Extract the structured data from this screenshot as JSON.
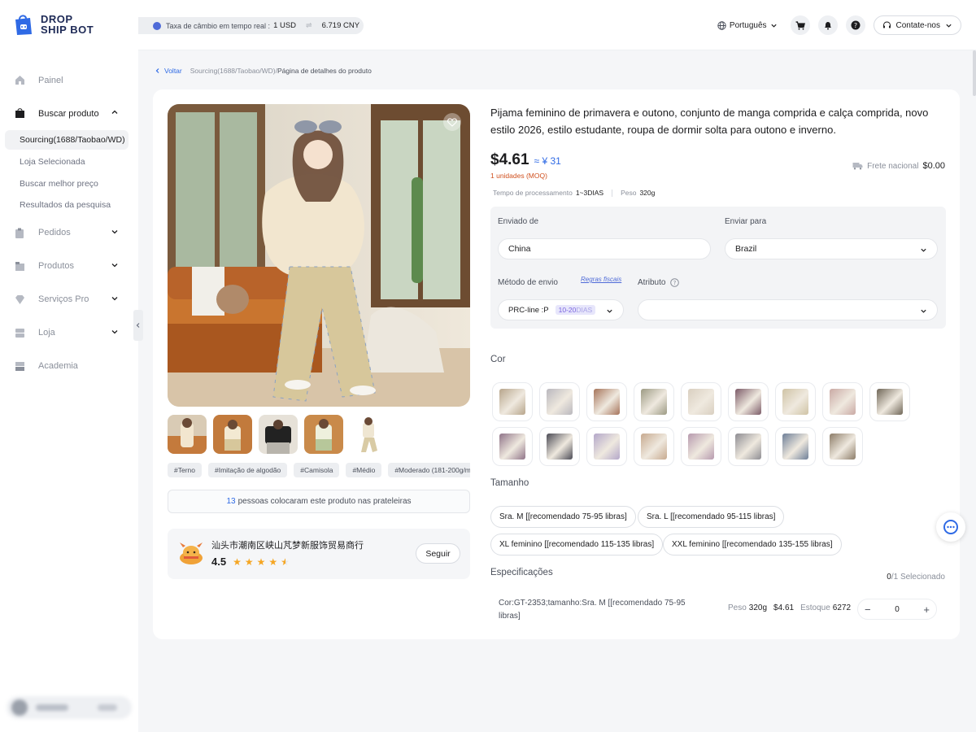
{
  "logo": {
    "line1": "DROP",
    "line2": "SHIP BOT"
  },
  "header": {
    "rate_label": "Taxa de câmbio em tempo real :",
    "rate_usd": "1 USD",
    "rate_cny": "6.719 CNY",
    "language": "Português",
    "contact": "Contate-nos"
  },
  "sidebar": {
    "items": [
      {
        "label": "Painel",
        "icon": "home-icon"
      },
      {
        "label": "Buscar produto",
        "icon": "bag-icon",
        "expanded": true
      },
      {
        "label": "Pedidos",
        "icon": "clipboard-icon"
      },
      {
        "label": "Produtos",
        "icon": "box-icon"
      },
      {
        "label": "Serviços Pro",
        "icon": "diamond-icon"
      },
      {
        "label": "Loja",
        "icon": "store-icon"
      },
      {
        "label": "Academia",
        "icon": "academy-icon"
      }
    ],
    "subitems": [
      {
        "label": "Sourcing(1688/Taobao/WD)",
        "selected": true
      },
      {
        "label": "Loja Selecionada"
      },
      {
        "label": "Buscar melhor preço"
      },
      {
        "label": "Resultados da pesquisa"
      }
    ]
  },
  "breadcrumb": {
    "back": "Voltar",
    "path": "Sourcing(1688/Taobao/WD)/",
    "current": "Página de detalhes do produto"
  },
  "product": {
    "title": "Pijama feminino de primavera e outono, conjunto de manga comprida e calça comprida, novo estilo 2026, estilo estudante, roupa de dormir solta para outono e inverno.",
    "price_usd": "$4.61",
    "price_cny": "≈ ¥ 31",
    "moq": "1 unidades (MOQ)",
    "processing_label": "Tempo de processamento",
    "processing_value": "1~3DIAS",
    "weight_label": "Peso",
    "weight_value": "320g",
    "shipping_label": "Frete nacional",
    "shipping_value": "$0.00"
  },
  "tags": [
    "#Terno",
    "#Imitação de algodão",
    "#Camisola",
    "#Médio",
    "#Moderado (181-200g/m"
  ],
  "shelf": {
    "count": "13",
    "text": "pessoas colocaram este produto nas prateleiras"
  },
  "shop": {
    "name": "汕头市潮南区峡山芃梦新服饰贸易商行",
    "rating": "4.5",
    "stars": 4.5,
    "follow": "Seguir"
  },
  "shipping": {
    "from_label": "Enviado de",
    "from_value": "China",
    "to_label": "Enviar para",
    "to_value": "Brazil",
    "method_label": "Método de envio",
    "rules_link": "Regras fiscais",
    "method_value": "PRC-line :P",
    "method_days": "10-20",
    "method_days_unit": "DIAS",
    "attribute_label": "Atributo"
  },
  "colors": {
    "label": "Cor",
    "swatches": [
      "#b7a58b",
      "#b9b7bd",
      "#a6745a",
      "#9c9a83",
      "#d9cfc0",
      "#7b5a67",
      "#cfc3a5",
      "#c9a9a4",
      "#6f6657",
      "#8f7488",
      "#4b4b55",
      "#b3a7c9",
      "#c7aa8f",
      "#b79aae",
      "#8d8c92",
      "#6e7f98",
      "#8c7c68"
    ]
  },
  "sizes": {
    "label": "Tamanho",
    "options": [
      "Sra. M [[recomendado 75-95 libras]",
      "Sra. L [[recomendado 95-115 libras]",
      "XL feminino [[recomendado 115-135 libras]",
      "XXL feminino [[recomendado 135-155 libras]"
    ]
  },
  "specs": {
    "label": "Especificações",
    "selected_count": "0",
    "selected_text": "/1 Selecionado",
    "row": {
      "name": "Cor:GT-2353;tamanho:Sra. M [[recomendado 75-95 libras]",
      "weight_label": "Peso",
      "weight": "320g",
      "price": "$4.61",
      "stock_label": "Estoque",
      "stock": "6272",
      "quantity": "0"
    }
  },
  "colors_theme": {
    "accent": "#2f6ae5",
    "moq": "#d0501e",
    "star": "#f5a623"
  }
}
